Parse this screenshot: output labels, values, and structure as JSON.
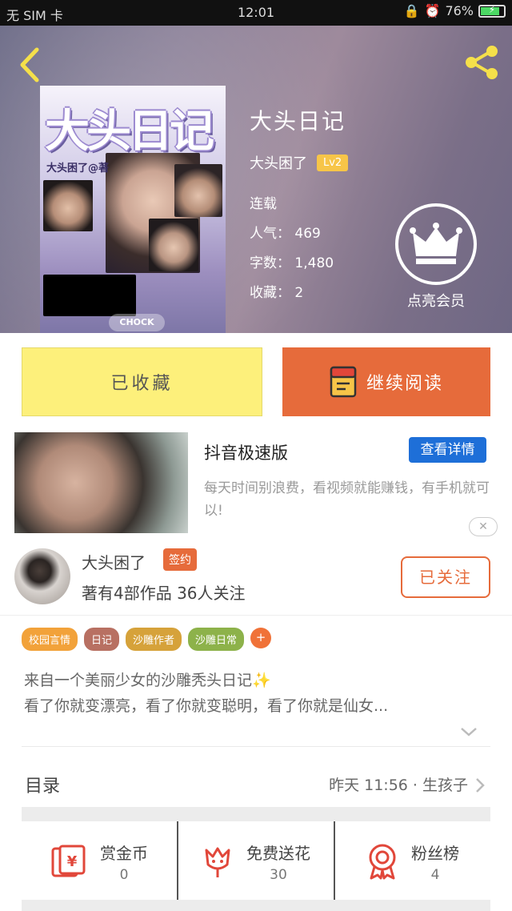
{
  "status_bar": {
    "carrier": "无 SIM 卡",
    "time": "12:01",
    "battery": "76%",
    "battery_level": 0.76
  },
  "book": {
    "cover_title": "大头日记",
    "cover_subtitle": "大头困了@著",
    "cover_button": "CHOCK",
    "title": "大头日记",
    "author": "大头困了",
    "level": "Lv2",
    "status": "连载",
    "popularity": "人气： 469",
    "words": "字数： 1,480",
    "favorites": "收藏： 2",
    "vip_label": "点亮会员"
  },
  "actions": {
    "favorited": "已收藏",
    "continue_reading": "继续阅读"
  },
  "ad": {
    "title": "抖音极速版",
    "detail_button": "查看详情",
    "description": "每天时间别浪费，看视频就能赚钱，有手机就可以!",
    "close": "✕"
  },
  "author_card": {
    "name": "大头困了",
    "signed_badge": "签约",
    "stats": "著有4部作品 36人关注",
    "follow_button": "已关注"
  },
  "tags": [
    {
      "label": "校园言情",
      "color": "#f2a23a"
    },
    {
      "label": "日记",
      "color": "#b87062"
    },
    {
      "label": "沙雕作者",
      "color": "#d6a23a"
    },
    {
      "label": "沙雕日常",
      "color": "#8db24a"
    }
  ],
  "tag_more": "+",
  "description": {
    "line1": "来自一个美丽少女的沙雕秃头日记✨",
    "line2": "看了你就变漂亮，看了你就变聪明，看了你就是仙女..."
  },
  "toc": {
    "label": "目录",
    "latest": "昨天 11:56 · 生孩子"
  },
  "stats": [
    {
      "label": "赏金币",
      "value": "0",
      "icon": "coin-envelope-icon"
    },
    {
      "label": "免费送花",
      "value": "30",
      "icon": "flower-icon"
    },
    {
      "label": "粉丝榜",
      "value": "4",
      "icon": "medal-icon"
    }
  ],
  "colors": {
    "accent": "#e66b3b",
    "favorite_bg": "#fdf07b",
    "ad_button": "#1e6fd8",
    "level_badge": "#f7c548"
  }
}
